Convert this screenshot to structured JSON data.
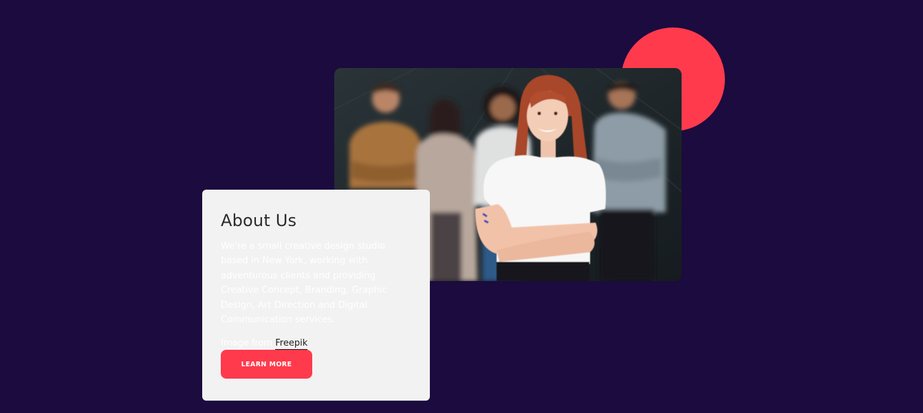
{
  "section": {
    "title": "About Us",
    "description": "We're a small creative design studio based in New York, working with adventurous clients and providing Creative Concept, Branding, Graphic Design, Art Direction and Digital Communication services.",
    "credit_prefix": "Image from",
    "credit_link": "Freepik",
    "button_label": "LEARN MORE"
  },
  "colors": {
    "background": "#1b0b3e",
    "accent": "#ff3a4d",
    "card": "#f2f2f2"
  },
  "icons": [
    "team-photo"
  ]
}
